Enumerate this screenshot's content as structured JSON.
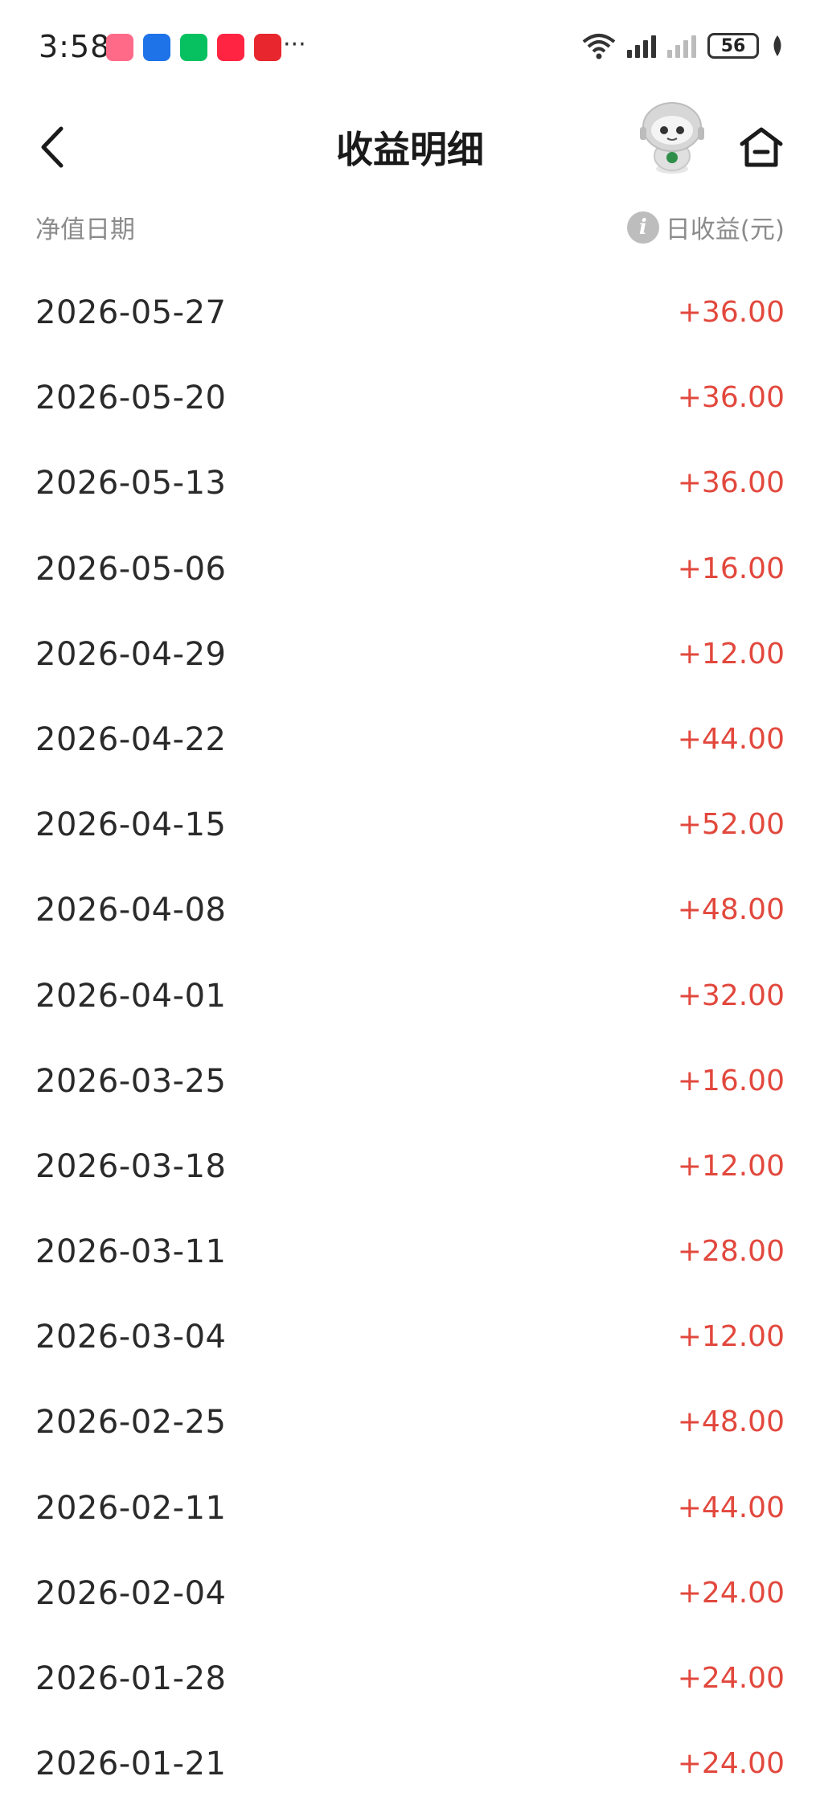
{
  "status_bar": {
    "time": "3:58",
    "more": "···",
    "battery": "56",
    "app_icons": [
      "red-app-icon",
      "blue-download-app-icon",
      "wechat-icon",
      "xiaohongshu-icon",
      "red-yellow-app-icon"
    ]
  },
  "header": {
    "title": "收益明细",
    "back_icon": "chevron-left-icon",
    "home_icon": "home-icon",
    "mascot": "robot-mascot"
  },
  "columns": {
    "left": "净值日期",
    "right": "日收益(元)",
    "info_icon": "i"
  },
  "colors": {
    "positive": "#e2483d",
    "muted": "#8c8c8c"
  },
  "rows": [
    {
      "date": "2026-05-27",
      "amount": "+36.00"
    },
    {
      "date": "2026-05-20",
      "amount": "+36.00"
    },
    {
      "date": "2026-05-13",
      "amount": "+36.00"
    },
    {
      "date": "2026-05-06",
      "amount": "+16.00"
    },
    {
      "date": "2026-04-29",
      "amount": "+12.00"
    },
    {
      "date": "2026-04-22",
      "amount": "+44.00"
    },
    {
      "date": "2026-04-15",
      "amount": "+52.00"
    },
    {
      "date": "2026-04-08",
      "amount": "+48.00"
    },
    {
      "date": "2026-04-01",
      "amount": "+32.00"
    },
    {
      "date": "2026-03-25",
      "amount": "+16.00"
    },
    {
      "date": "2026-03-18",
      "amount": "+12.00"
    },
    {
      "date": "2026-03-11",
      "amount": "+28.00"
    },
    {
      "date": "2026-03-04",
      "amount": "+12.00"
    },
    {
      "date": "2026-02-25",
      "amount": "+48.00"
    },
    {
      "date": "2026-02-11",
      "amount": "+44.00"
    },
    {
      "date": "2026-02-04",
      "amount": "+24.00"
    },
    {
      "date": "2026-01-28",
      "amount": "+24.00"
    },
    {
      "date": "2026-01-21",
      "amount": "+24.00"
    }
  ]
}
